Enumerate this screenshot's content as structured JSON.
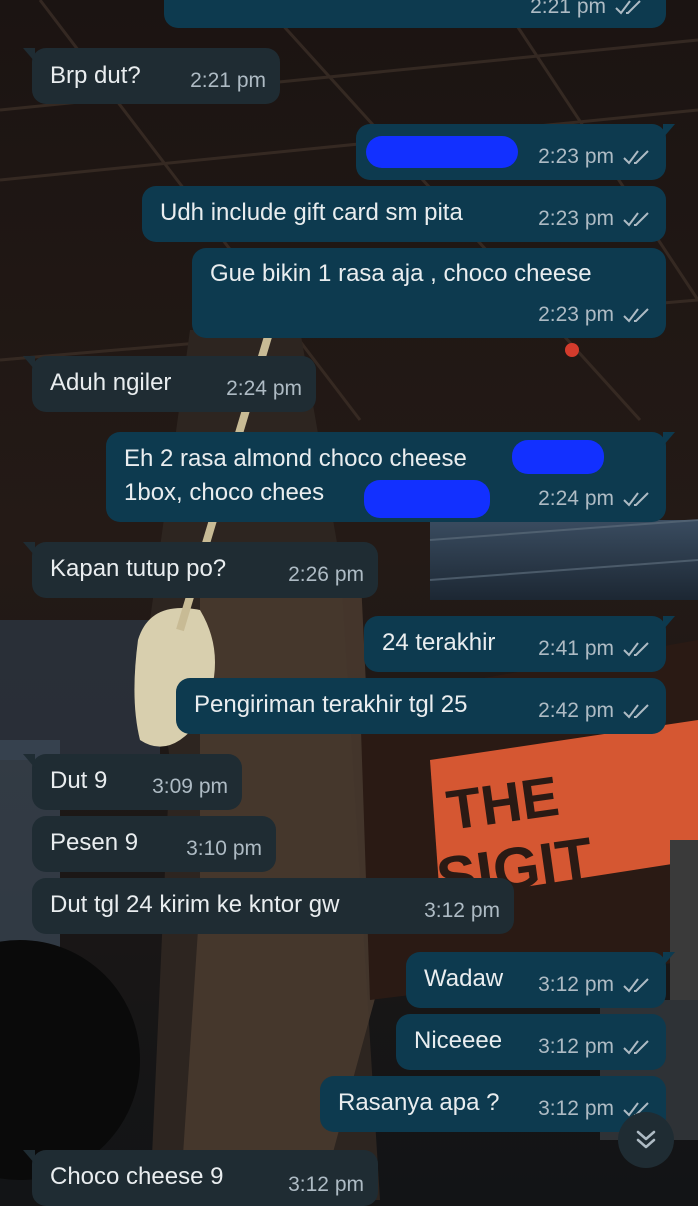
{
  "colors": {
    "incoming_bubble": "#1f2c33",
    "outgoing_bubble": "#0d3a4f",
    "text": "#e9edef",
    "meta": "#aebbc4",
    "redaction": "#1230ff"
  },
  "messages": [
    {
      "dir": "out",
      "text": "",
      "time": "2:21 pm",
      "read": true
    },
    {
      "dir": "in",
      "text": "Brp dut?",
      "time": "2:21 pm"
    },
    {
      "dir": "out",
      "text": "",
      "time": "2:23 pm",
      "read": true,
      "redacted": true
    },
    {
      "dir": "out",
      "text": "Udh include gift card sm pita",
      "time": "2:23 pm",
      "read": true
    },
    {
      "dir": "out",
      "text": "Gue bikin 1 rasa aja , choco cheese",
      "time": "2:23 pm",
      "read": true
    },
    {
      "dir": "in",
      "text": "Aduh ngiler",
      "time": "2:24 pm"
    },
    {
      "dir": "out",
      "text_line1": "Eh 2 rasa almond choco cheese",
      "text_line2": "1box, choco chees",
      "time": "2:24 pm",
      "read": true,
      "redacted": true
    },
    {
      "dir": "in",
      "text": "Kapan tutup po?",
      "time": "2:26 pm"
    },
    {
      "dir": "out",
      "text": "24 terakhir",
      "time": "2:41 pm",
      "read": true
    },
    {
      "dir": "out",
      "text": "Pengiriman terakhir tgl 25",
      "time": "2:42 pm",
      "read": true
    },
    {
      "dir": "in",
      "text": "Dut 9",
      "time": "3:09 pm"
    },
    {
      "dir": "in",
      "text": "Pesen 9",
      "time": "3:10 pm"
    },
    {
      "dir": "in",
      "text": "Dut tgl 24 kirim ke kntor gw",
      "time": "3:12 pm"
    },
    {
      "dir": "out",
      "text": "Wadaw",
      "time": "3:12 pm",
      "read": true
    },
    {
      "dir": "out",
      "text": "Niceeee",
      "time": "3:12 pm",
      "read": true
    },
    {
      "dir": "out",
      "text": "Rasanya apa ?",
      "time": "3:12 pm",
      "read": true
    },
    {
      "dir": "in",
      "text": "Choco cheese 9",
      "time": "3:12 pm"
    }
  ],
  "wallpaper": {
    "banner_text_1": "THE",
    "banner_text_2": "SIGIT"
  },
  "scroll_button": {
    "icon": "double-chevron-down-icon"
  }
}
